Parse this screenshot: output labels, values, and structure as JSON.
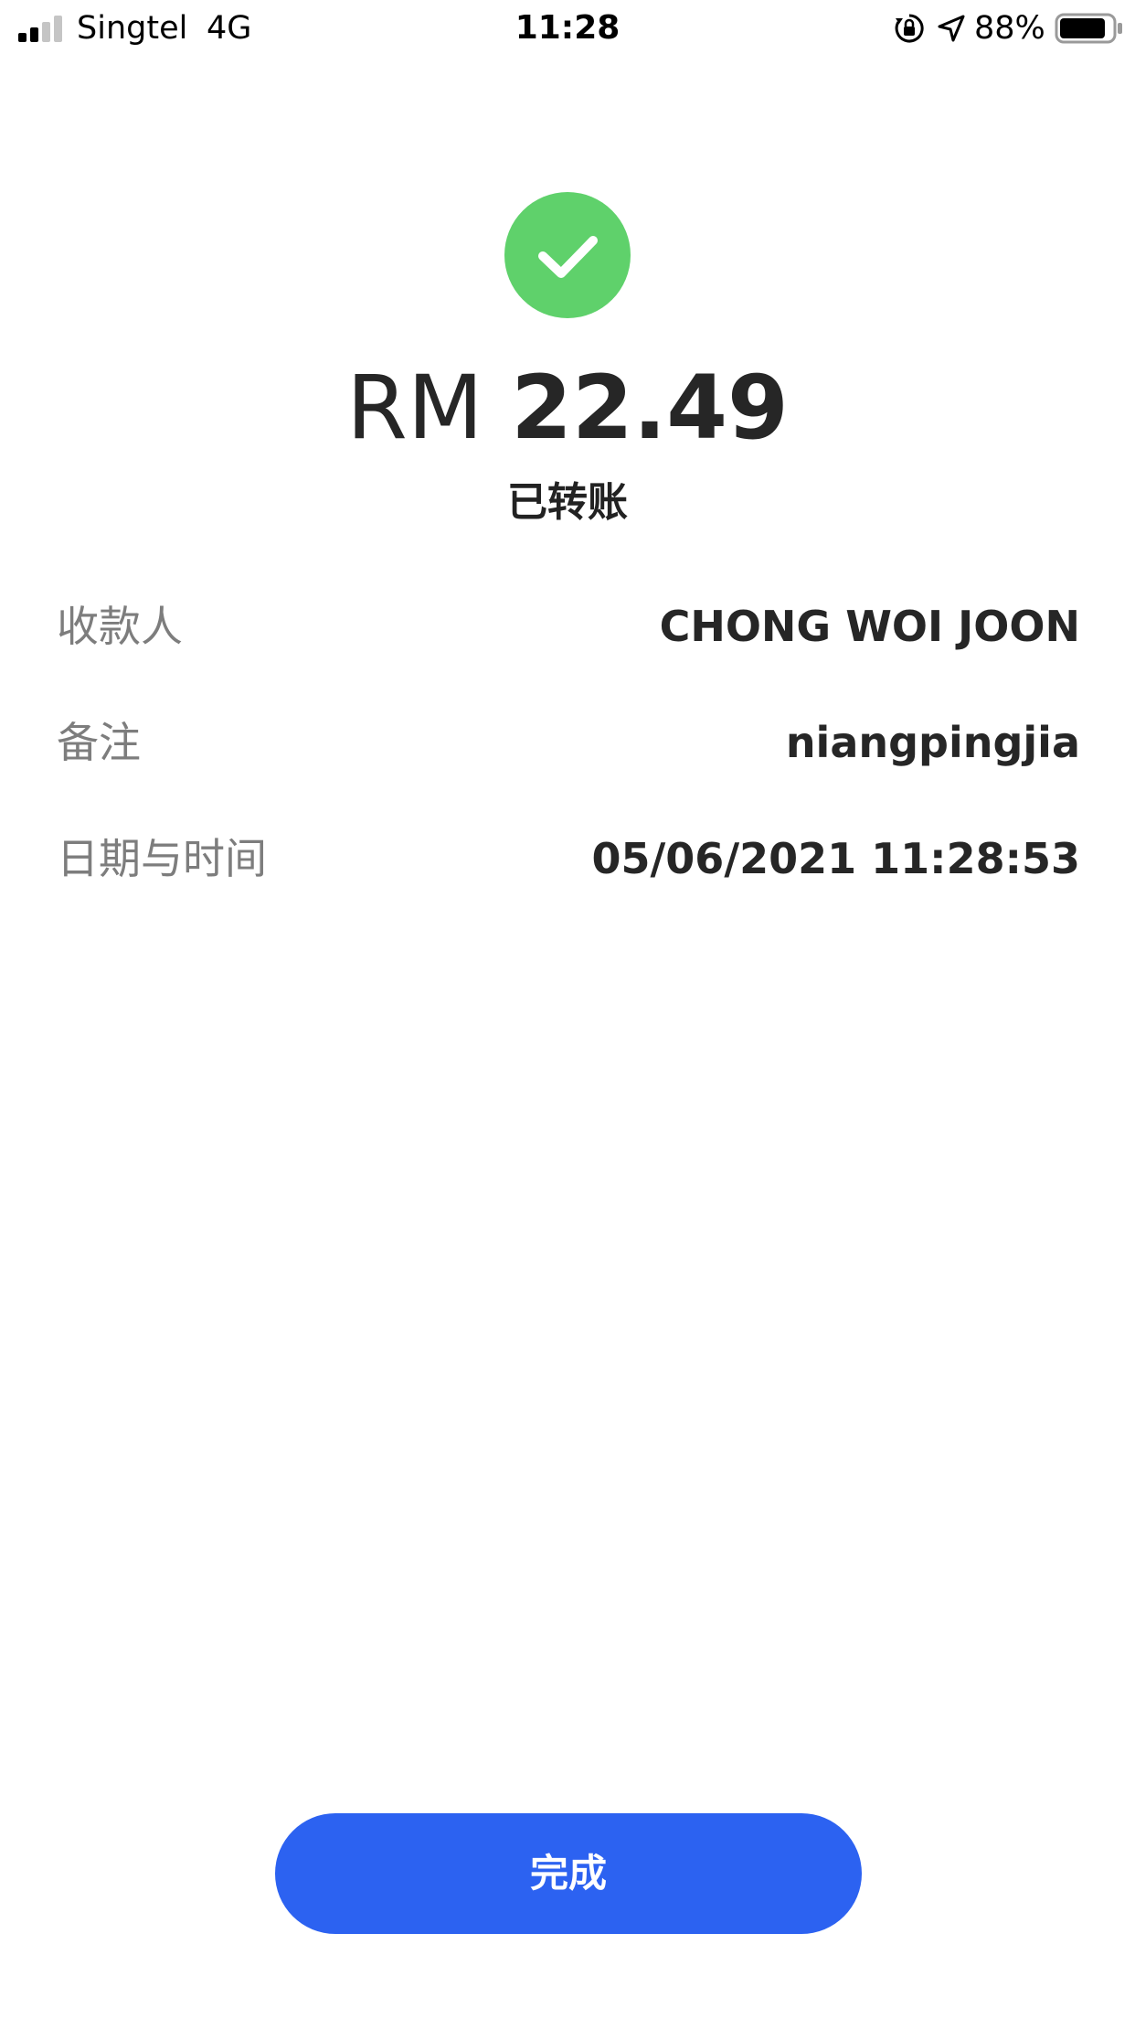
{
  "status_bar": {
    "carrier": "Singtel",
    "network": "4G",
    "time": "11:28",
    "battery_percent": "88%",
    "battery_level": 0.88,
    "signal_bars_active": 2,
    "signal_bars_total": 4,
    "icons": [
      "signal-icon",
      "orientation-lock-icon",
      "location-icon",
      "battery-icon"
    ]
  },
  "result": {
    "icon": "success-check-icon",
    "currency": "RM",
    "amount": "22.49",
    "status": "已转账"
  },
  "details": {
    "recipient": {
      "label": "收款人",
      "value": "CHONG WOI JOON"
    },
    "note": {
      "label": "备注",
      "value": "niangpingjia"
    },
    "datetime": {
      "label": "日期与时间",
      "value": "05/06/2021 11:28:53"
    }
  },
  "actions": {
    "done_label": "完成"
  },
  "colors": {
    "success_green": "#5fd16b",
    "primary_blue": "#2c62f1",
    "label_gray": "#7d7d7d",
    "text_dark": "#262626"
  }
}
